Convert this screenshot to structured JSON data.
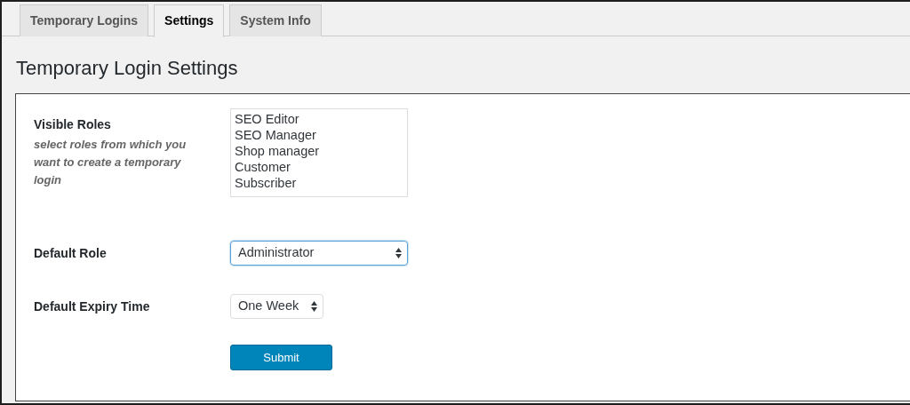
{
  "tabs": [
    {
      "label": "Temporary Logins",
      "selected": false
    },
    {
      "label": "Settings",
      "selected": true
    },
    {
      "label": "System Info",
      "selected": false
    }
  ],
  "page_title": "Temporary Login Settings",
  "form": {
    "visible_roles": {
      "label": "Visible Roles",
      "description": "select roles from which you want to create a temporary login",
      "options": [
        {
          "label": "SEO Editor",
          "selected": false
        },
        {
          "label": "SEO Manager",
          "selected": false
        },
        {
          "label": "Shop manager",
          "selected": false
        },
        {
          "label": "Customer",
          "selected": false
        },
        {
          "label": "Subscriber",
          "selected": false
        }
      ]
    },
    "default_role": {
      "label": "Default Role",
      "value": "Administrator",
      "focused": true
    },
    "default_expiry": {
      "label": "Default Expiry Time",
      "value": "One Week",
      "focused": false
    },
    "submit": "Submit"
  }
}
